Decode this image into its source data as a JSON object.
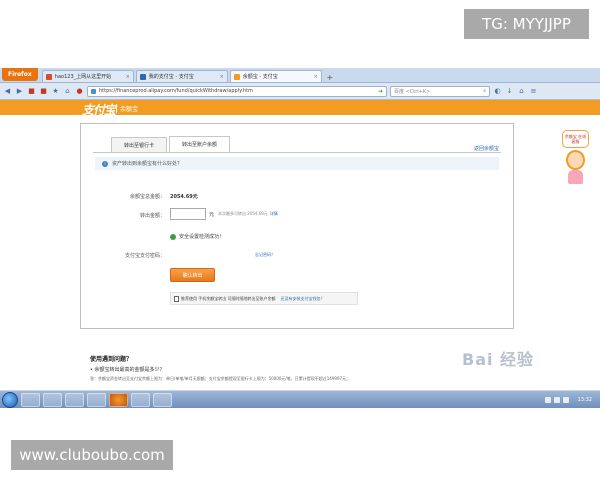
{
  "watermark_top": "TG: MYYJJPP",
  "watermark_bottom": "www.cluboubo.com",
  "browser": {
    "menu_button": "Firefox",
    "tabs": [
      {
        "label": "hao123_上网从这里开始"
      },
      {
        "label": "我的支付宝 - 支付宝"
      },
      {
        "label": "余额宝 - 支付宝"
      }
    ],
    "url": "https://financeprod.alipay.com/fund/quickWithdraw/apply.htm",
    "search_placeholder": "百度 <Ctrl+K>"
  },
  "site": {
    "logo": "支付宝",
    "section": "余额宝"
  },
  "panel": {
    "tabs": [
      "转出至银行卡",
      "转出至账户余额"
    ],
    "active_tab": 1,
    "help_link": "返回余额宝",
    "notice": "资产转出到余额宝有什么好处？",
    "balance_label": "余额宝总金额：",
    "balance_value": "2054.69元",
    "amount_label": "转出金额：",
    "amount_unit": "元",
    "amount_limit": "本次最多可转出 2054.69元",
    "amount_limit_link": "详情",
    "safe_text": "安全设置检测成功！",
    "pay_password_label": "支付宝支付密码：",
    "forgot_password_link": "忘记密码？",
    "confirm_button": "确认转出",
    "promo_text": "推荐使用 手机余额宝转出 可随时随地转出至账户余额",
    "promo_link": "还没有安装支付宝钱包？"
  },
  "cartoon_bubble": "余额宝 在线客服",
  "faq": {
    "title": "使用遇到问题？",
    "question": "• 余额宝转出最高的金额是多少？",
    "answer": "答：余额宝资金转出至支付宝余额上限为：单日/单笔/单月无限额；支付宝余额提现至银行卡上限为：50000元/笔，日累计提现不超过149997元；"
  },
  "baidu_watermark": "Bai 经验",
  "taskbar": {
    "clock": "13:32"
  }
}
